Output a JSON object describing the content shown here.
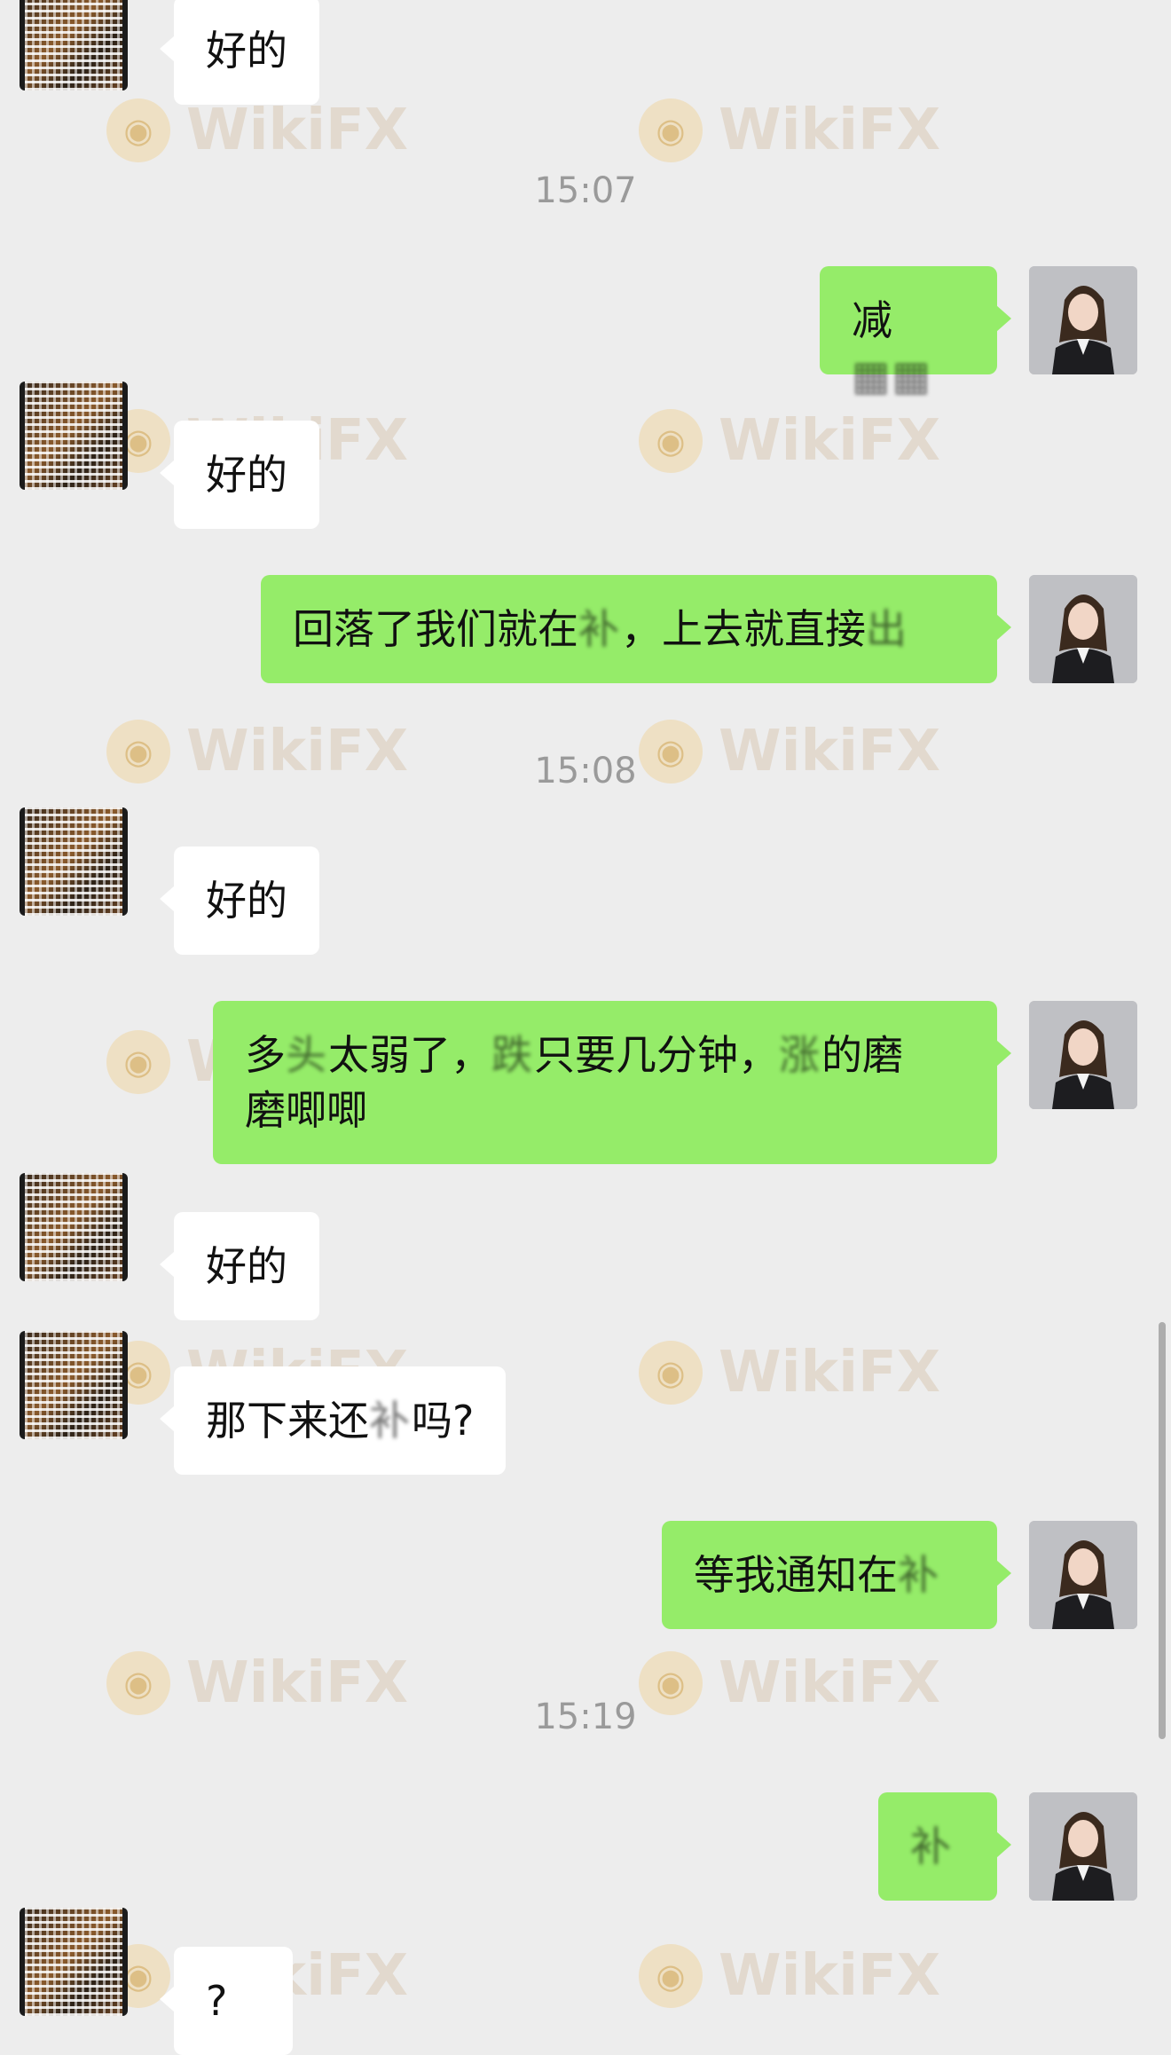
{
  "watermark_text": "WikiFX",
  "messages": {
    "m1": {
      "text": "好的"
    },
    "t1": {
      "text": "15:07"
    },
    "m2": {
      "text": "减",
      "blurred": ""
    },
    "m3": {
      "text": "好的"
    },
    "m4": {
      "text": "回落了我们就在",
      "blurred_a": "补",
      "text_b": "，上去就直接",
      "blurred_b": "出"
    },
    "t2": {
      "text": "15:08"
    },
    "m5": {
      "text": "好的"
    },
    "m6": {
      "text_a": "多",
      "blurred_a": "头",
      "text_b": "太弱了，",
      "blurred_b": "跌",
      "text_c": "只要几分钟，",
      "blurred_c": "涨",
      "text_d": "的磨",
      "line2": "磨唧唧"
    },
    "m7": {
      "text": "好的"
    },
    "m8": {
      "text_a": "那下来还",
      "blurred_a": "补",
      "text_b": "吗?"
    },
    "m9": {
      "text": "等我通知在",
      "blurred_a": "补"
    },
    "t3": {
      "text": "15:19"
    },
    "m10": {
      "blurred_a": "补"
    },
    "m11": {
      "text": "?"
    }
  },
  "colors": {
    "background": "#ededed",
    "self_bubble": "#95ec69",
    "peer_bubble": "#ffffff",
    "timestamp": "#9a9a9a"
  },
  "icons": {
    "peer_avatar": "pixelated-avatar",
    "self_avatar": "woman-in-suit-avatar"
  }
}
